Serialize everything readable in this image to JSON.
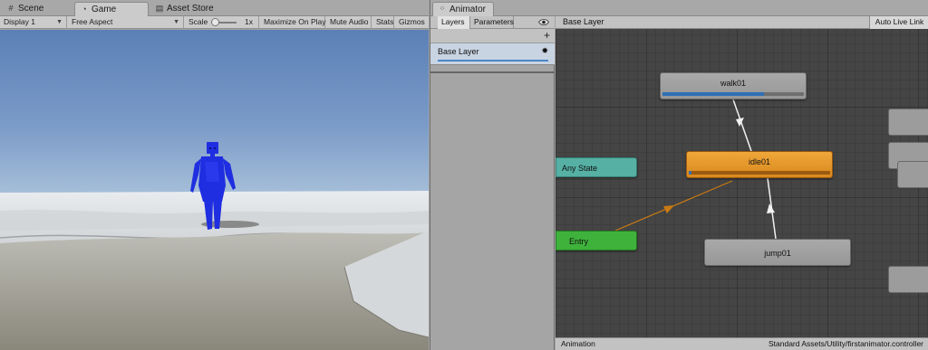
{
  "left_tabs": {
    "scene": "Scene",
    "game": "Game",
    "asset_store": "Asset Store"
  },
  "game_toolbar": {
    "display": "Display 1",
    "aspect": "Free Aspect",
    "scale_label": "Scale",
    "scale_value": "1x",
    "maximize": "Maximize On Play",
    "mute": "Mute Audio",
    "stats": "Stats",
    "gizmos": "Gizmos"
  },
  "animator": {
    "tab": "Animator",
    "layers_tab": "Layers",
    "parameters_tab": "Parameters",
    "add_symbol": "+",
    "layer_name": "Base Layer",
    "breadcrumb": "Base Layer",
    "live_link": "Auto Live Link",
    "footer_left": "Animation",
    "footer_right": "Standard Assets/Utility/firstanimator.controller",
    "states": {
      "walk": "walk01",
      "idle": "idle01",
      "jump": "jump01",
      "any": "Any State",
      "entry": "Entry"
    },
    "walk_progress": 0.72,
    "idle_progress": 0.02
  },
  "colors": {
    "idle_state": "#e8982e",
    "any_state": "#56b0a4",
    "entry_state": "#3fb23c",
    "character": "#1f2ee0",
    "entry_transition": "#c97a12"
  },
  "icons": {
    "scene": "hash-icon",
    "game": "pacman-icon",
    "asset_store": "store-icon",
    "animator": "animator-icon",
    "visibility": "eye-icon",
    "layer_settings": "gear-icon"
  }
}
